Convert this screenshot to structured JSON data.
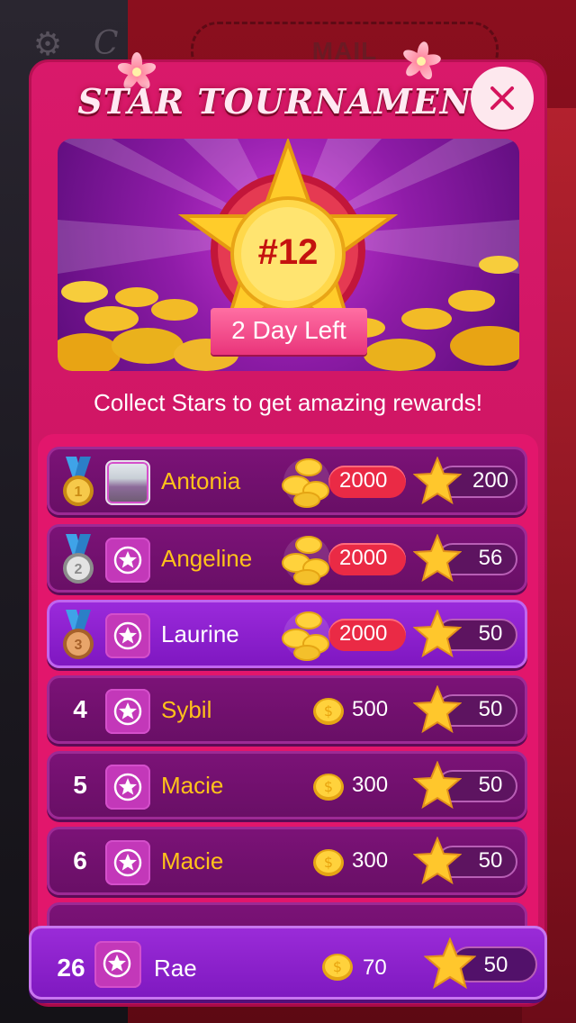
{
  "background": {
    "gear_icon": "gear-icon",
    "script_text": "C",
    "mail_label": "MAIL"
  },
  "dialog": {
    "title": "STAR TOURNAMENT",
    "close_icon": "close-icon"
  },
  "banner": {
    "rank": "#12",
    "days_left": "2 Day Left"
  },
  "subtitle": "Collect Stars to get amazing rewards!",
  "leaderboard": [
    {
      "rank": "1",
      "medal": "gold",
      "name": "Antonia",
      "coins": "2000",
      "stars": "200",
      "avatar": "photo"
    },
    {
      "rank": "2",
      "medal": "silver",
      "name": "Angeline",
      "coins": "2000",
      "stars": "56",
      "avatar": "star"
    },
    {
      "rank": "3",
      "medal": "bronze",
      "name": "Laurine",
      "coins": "2000",
      "stars": "50",
      "avatar": "star",
      "is_me": true
    },
    {
      "rank": "4",
      "name": "Sybil",
      "coins": "500",
      "stars": "50",
      "avatar": "star"
    },
    {
      "rank": "5",
      "name": "Macie",
      "coins": "300",
      "stars": "50",
      "avatar": "star"
    },
    {
      "rank": "6",
      "name": "Macie",
      "coins": "300",
      "stars": "50",
      "avatar": "star"
    }
  ],
  "my_entry": {
    "rank": "26",
    "name": "Rae",
    "coins": "70",
    "stars": "50"
  },
  "colors": {
    "dialog_bg": "#d9196a",
    "row_bg": "#7b1277",
    "highlight_row_bg": "#9a2adb",
    "name_color": "#ffc21a",
    "coin_pill": "#ea2a45"
  }
}
